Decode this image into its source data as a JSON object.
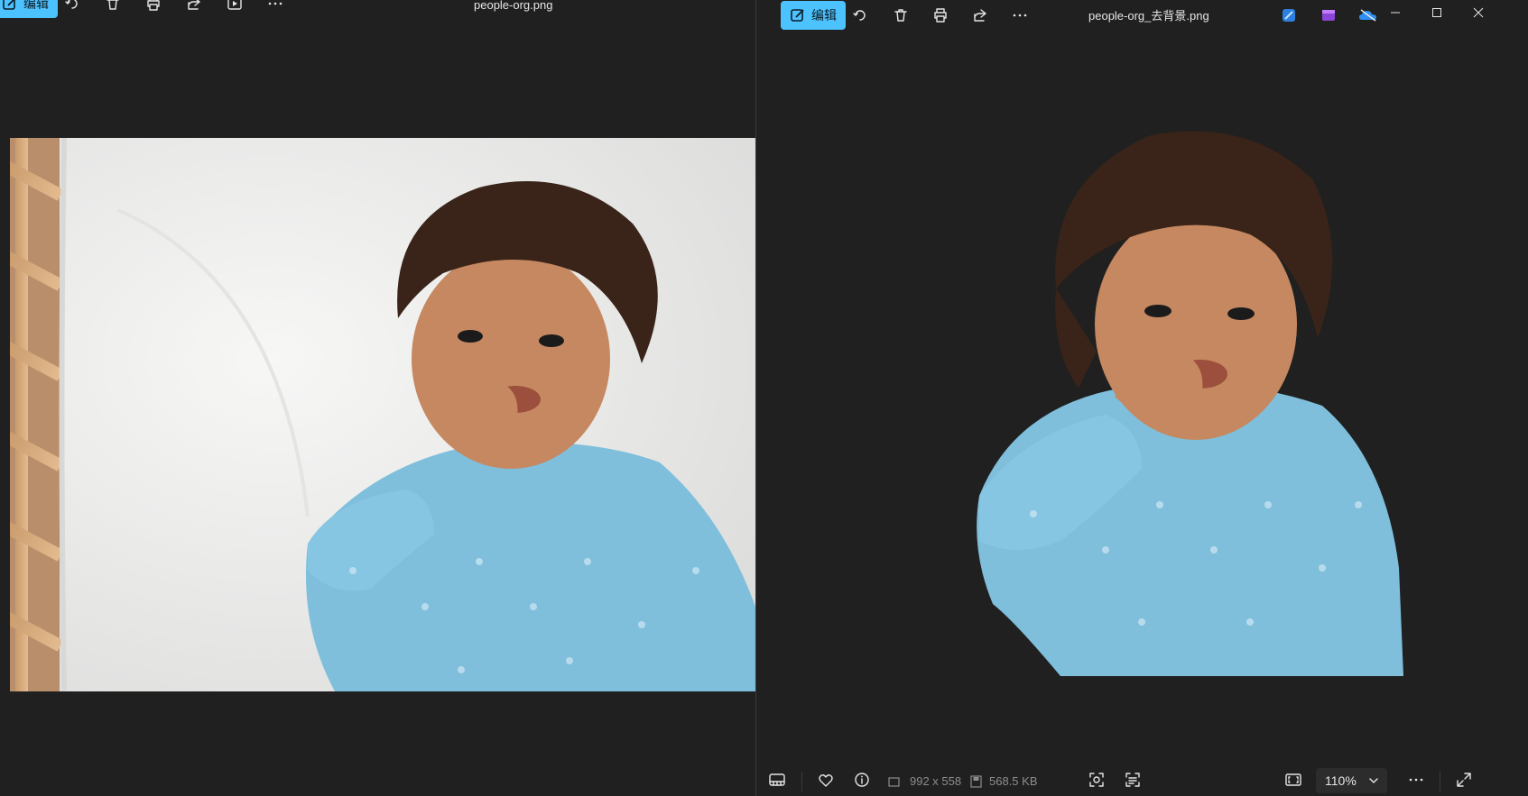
{
  "left_window": {
    "title": "people-org.png",
    "toolbar": {
      "edit_label": "编辑",
      "icons": [
        "edit-icon",
        "rotate-icon",
        "delete-icon",
        "print-icon",
        "share-icon",
        "slideshow-icon",
        "more-icon"
      ]
    }
  },
  "right_window": {
    "title": "people-org_去背景.png",
    "toolbar": {
      "edit_label": "编辑",
      "icons": [
        "edit-icon",
        "rotate-icon",
        "delete-icon",
        "print-icon",
        "share-icon",
        "more-icon"
      ]
    },
    "app_icons": [
      "designer-icon",
      "clipchamp-icon",
      "onedrive-icon"
    ],
    "status_bar": {
      "dimensions": "992 x 558",
      "file_size": "568.5 KB",
      "zoom": "110%"
    }
  },
  "colors": {
    "background": "#202020",
    "accent": "#4cc2ff",
    "shirt": "#7fbfdc",
    "sheet": "#eeeeec"
  }
}
